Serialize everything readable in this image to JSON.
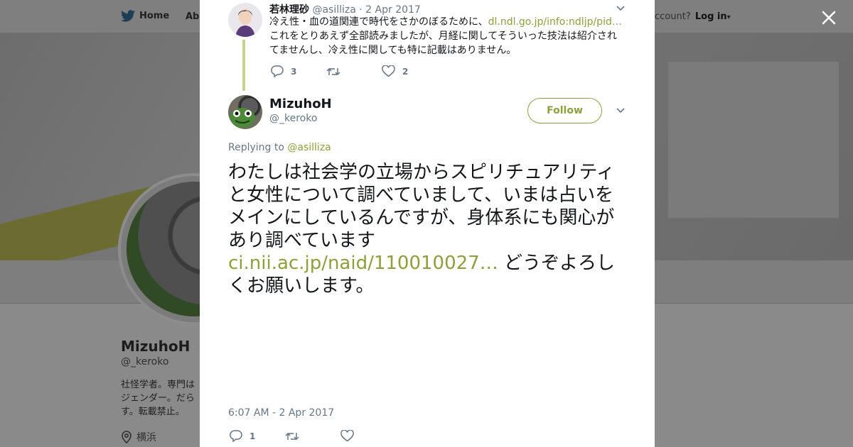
{
  "background": {
    "nav": {
      "home_label": "Home",
      "about_label": "Abo",
      "account_prompt": "ccount?",
      "login_label": "Log in"
    },
    "profile": {
      "name": "MizuhoH",
      "handle": "@_keroko",
      "bio": "社怪学者。専門は\nジェンダー。だら\nす。転載禁止。",
      "location": "横浜"
    }
  },
  "modal": {
    "parent_tweet": {
      "author_name": "若林理砂",
      "author_handle": "@asilliza",
      "date": "· 2 Apr 2017",
      "text_before_link": "冷え性・血の道関連で時代をさかのぼるために、",
      "link": "dl.ndl.go.jp/info:ndljp/pid…",
      "text_after_link": " これをとりあえず全部読みましたが、月経に関してそういった技法は紹介されてませんし、冷え性に関しても特に記載はありません。",
      "reply_count": "3",
      "retweet_count": "",
      "like_count": "2"
    },
    "main_tweet": {
      "author_name": "MizuhoH",
      "author_handle": "@_keroko",
      "follow_label": "Follow",
      "replying_prefix": "Replying to ",
      "replying_handle": "@asilliza",
      "text_before_link": "わたしは社会学の立場からスピリチュアリティと女性について調べていまして、いまは占いをメインにしているんですが、身体系にも関心があり調べています ",
      "link": "ci.nii.ac.jp/naid/110010027…",
      "text_after_link": " どうぞよろしくお願いします。",
      "timestamp": "6:07 AM - 2 Apr 2017",
      "reply_count": "1",
      "retweet_count": "",
      "like_count": ""
    }
  },
  "colors": {
    "accent": "#8ba23a",
    "thread_line": "#c8d28b",
    "secondary_text": "#657786",
    "overlay": "#8a8a8a"
  },
  "icons": [
    "twitter-bird-icon",
    "close-icon",
    "reply-icon",
    "retweet-icon",
    "heart-icon",
    "chevron-down-icon",
    "location-pin-icon"
  ]
}
